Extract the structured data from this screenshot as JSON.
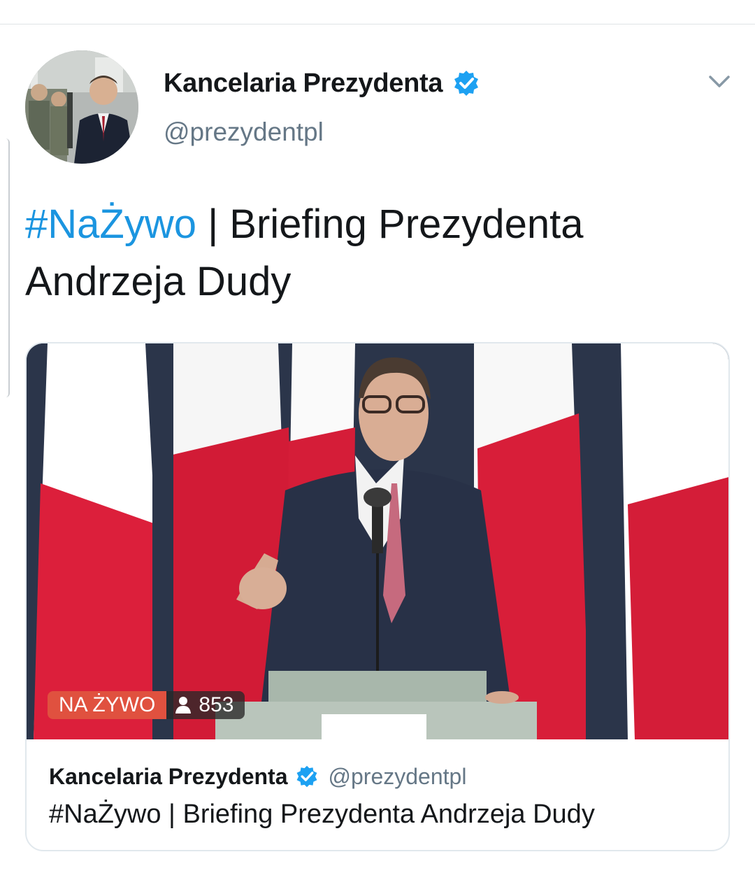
{
  "tweet": {
    "author": {
      "display_name": "Kancelaria Prezydenta",
      "handle": "@prezydentpl",
      "verified": true,
      "avatar_icon": "avatar-photo"
    },
    "menu_icon": "chevron-down-icon",
    "text": {
      "hashtag": "#NaŻywo",
      "body": " | Briefing Prezydenta Andrzeja Dudy"
    }
  },
  "card": {
    "live_label": "NA ŻYWO",
    "viewer_count": "853",
    "viewer_icon": "person-icon",
    "author": {
      "display_name": "Kancelaria Prezydenta",
      "handle": "@prezydentpl",
      "verified": true
    },
    "text": "#NaŻywo | Briefing Prezydenta Andrzeja Dudy"
  },
  "colors": {
    "link_blue": "#1b95e0",
    "live_red": "#e0513f",
    "secondary_text": "#657786",
    "border": "#e1e8ed"
  }
}
